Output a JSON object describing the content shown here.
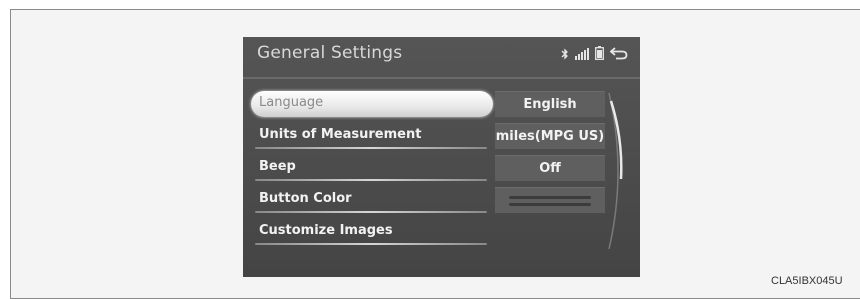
{
  "header": {
    "title": "General Settings",
    "icons": [
      "bluetooth-icon",
      "signal-strength-icon",
      "battery-icon",
      "back-icon"
    ]
  },
  "settings": [
    {
      "label": "Language",
      "value": "English",
      "selected": true
    },
    {
      "label": "Units of Measurement",
      "value": "miles(MPG US)",
      "selected": false
    },
    {
      "label": "Beep",
      "value": "Off",
      "selected": false
    },
    {
      "label": "Button Color",
      "value": "",
      "selected": false
    },
    {
      "label": "Customize Images",
      "value": "",
      "selected": false
    }
  ],
  "credit": "CLA5IBX045U"
}
